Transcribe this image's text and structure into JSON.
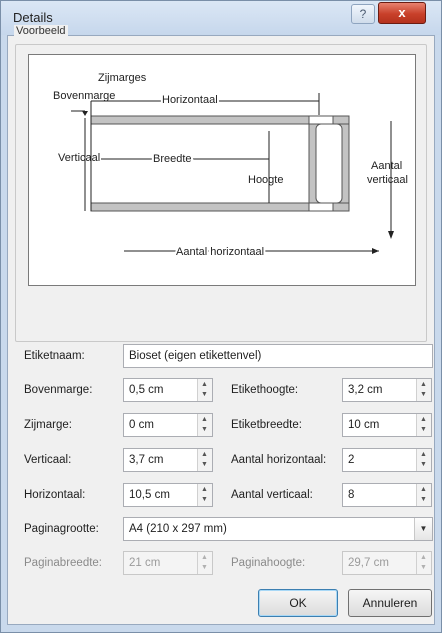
{
  "window": {
    "title": "Details",
    "help_glyph": "?",
    "close_glyph": "x"
  },
  "preview": {
    "group_label": "Voorbeeld",
    "labels": {
      "zijmarges": "Zijmarges",
      "bovenmarge": "Bovenmarge",
      "horizontaal": "Horizontaal",
      "verticaal": "Verticaal",
      "breedte": "Breedte",
      "hoogte": "Hoogte",
      "aantal_verticaal_1": "Aantal",
      "aantal_verticaal_2": "verticaal",
      "aantal_horizontaal": "Aantal horizontaal"
    }
  },
  "form": {
    "etiketnaam_label": "Etiketnaam:",
    "etiketnaam_value": "Bioset (eigen etikettenvel)",
    "bovenmarge_label": "Bovenmarge:",
    "bovenmarge_value": "0,5 cm",
    "zijmarge_label": "Zijmarge:",
    "zijmarge_value": "0 cm",
    "verticaal_label": "Verticaal:",
    "verticaal_value": "3,7 cm",
    "horizontaal_label": "Horizontaal:",
    "horizontaal_value": "10,5 cm",
    "etikethoogte_label": "Etikethoogte:",
    "etikethoogte_value": "3,2 cm",
    "etiketbreedte_label": "Etiketbreedte:",
    "etiketbreedte_value": "10 cm",
    "aantal_horizontaal_label": "Aantal horizontaal:",
    "aantal_horizontaal_value": "2",
    "aantal_verticaal_label": "Aantal verticaal:",
    "aantal_verticaal_value": "8",
    "paginagrootte_label": "Paginagrootte:",
    "paginagrootte_value": "A4 (210 x 297 mm)",
    "paginabreedte_label": "Paginabreedte:",
    "paginabreedte_value": "21 cm",
    "paginahoogte_label": "Paginahoogte:",
    "paginahoogte_value": "29,7 cm"
  },
  "buttons": {
    "ok": "OK",
    "cancel": "Annuleren"
  }
}
